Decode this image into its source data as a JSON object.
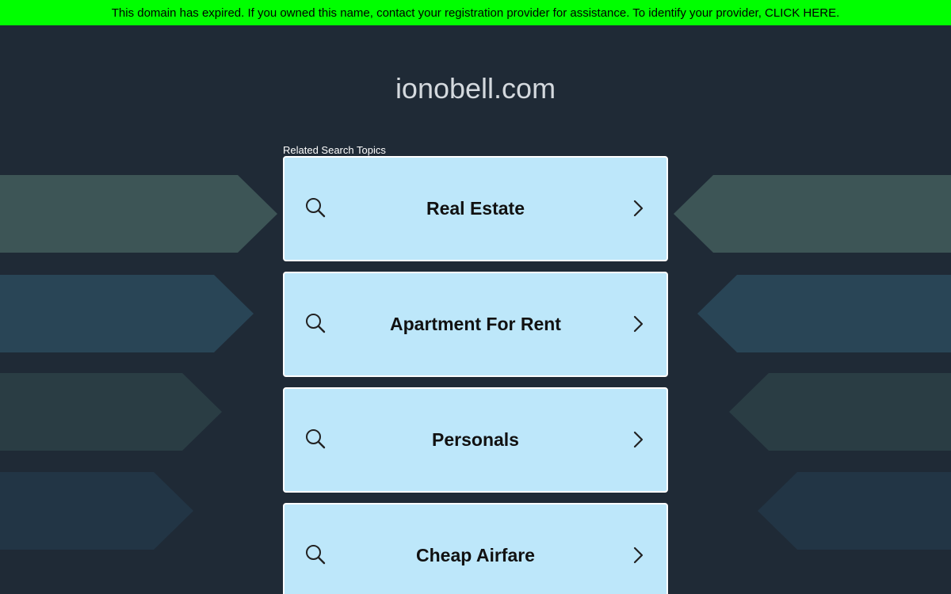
{
  "banner": {
    "text": "This domain has expired. If you owned this name, contact your registration provider for assistance. To identify your provider, ",
    "link_text": "CLICK HERE",
    "suffix": ".",
    "background": "#00ff00"
  },
  "domain": "ionobell.com",
  "related_label": "Related Search Topics",
  "topics": [
    {
      "label": "Real Estate",
      "icon": "search-icon",
      "chevron": "chevron-right-icon"
    },
    {
      "label": "Apartment For Rent",
      "icon": "search-icon",
      "chevron": "chevron-right-icon"
    },
    {
      "label": "Personals",
      "icon": "search-icon",
      "chevron": "chevron-right-icon"
    },
    {
      "label": "Cheap Airfare",
      "icon": "search-icon",
      "chevron": "chevron-right-icon"
    }
  ],
  "colors": {
    "page_background": "#1f2a36",
    "card_background": "#bde7fa",
    "title_text": "#d4d9de"
  }
}
